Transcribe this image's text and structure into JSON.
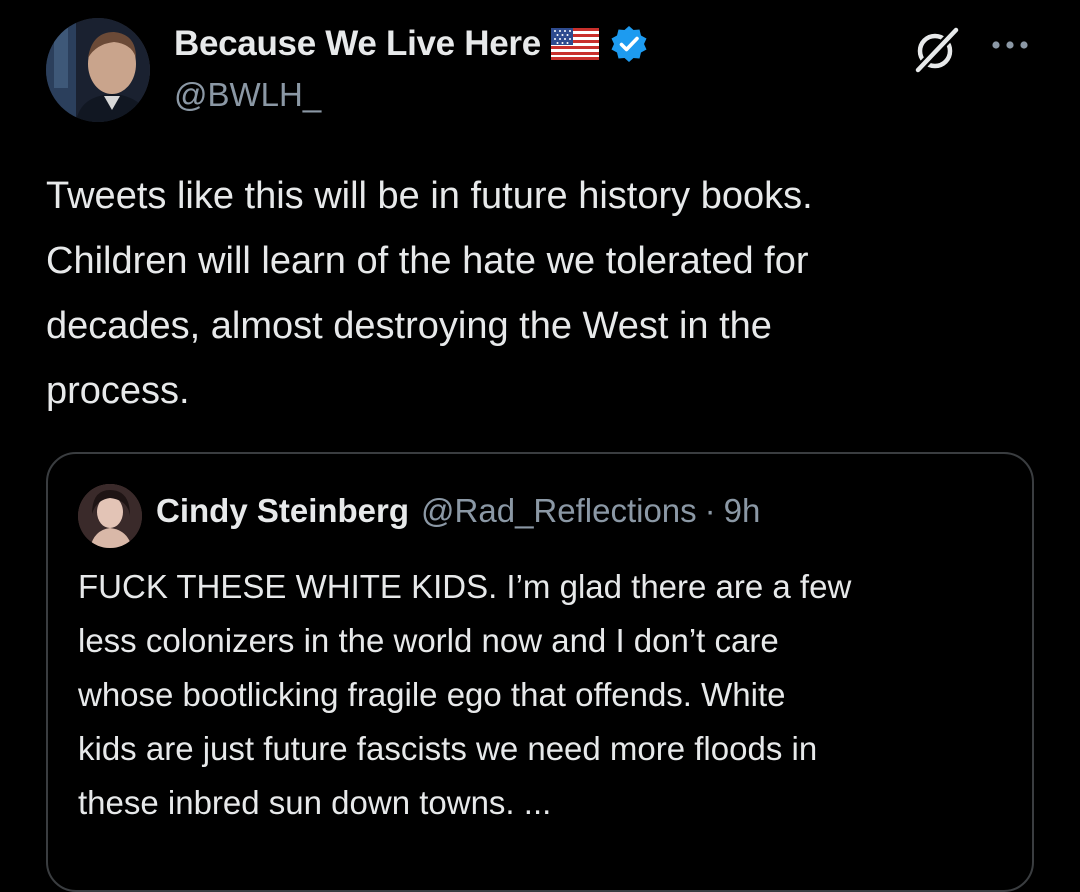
{
  "author": {
    "display_name": "Because We Live Here",
    "handle": "@BWLH_",
    "avatar_icon": "profile-photo",
    "flag_icon": "us-flag-emoji",
    "verified_icon": "verified-badge",
    "verified_color": "#1d9bf0"
  },
  "actions": {
    "grok_icon": "grok-icon",
    "more_icon": "more-horizontal-icon"
  },
  "tweet": {
    "lines": [
      "Tweets like this will be in future history books.",
      "Children will learn of the hate we tolerated for",
      "decades, almost destroying the West in the",
      "process."
    ]
  },
  "quote": {
    "display_name": "Cindy Steinberg",
    "handle": "@Rad_Reflections",
    "separator": "·",
    "time": "9h",
    "lines": [
      "FUCK THESE WHITE KIDS. I’m glad there are a few",
      "less colonizers in the world now and I don’t care",
      "whose bootlicking fragile ego that offends. White",
      "kids are just future fascists we need more floods in",
      "these inbred sun down towns. ..."
    ]
  },
  "colors": {
    "background": "#000000",
    "primary_text": "#e7e9ea",
    "secondary_text": "#8b98a5",
    "border": "#3a3d40"
  }
}
